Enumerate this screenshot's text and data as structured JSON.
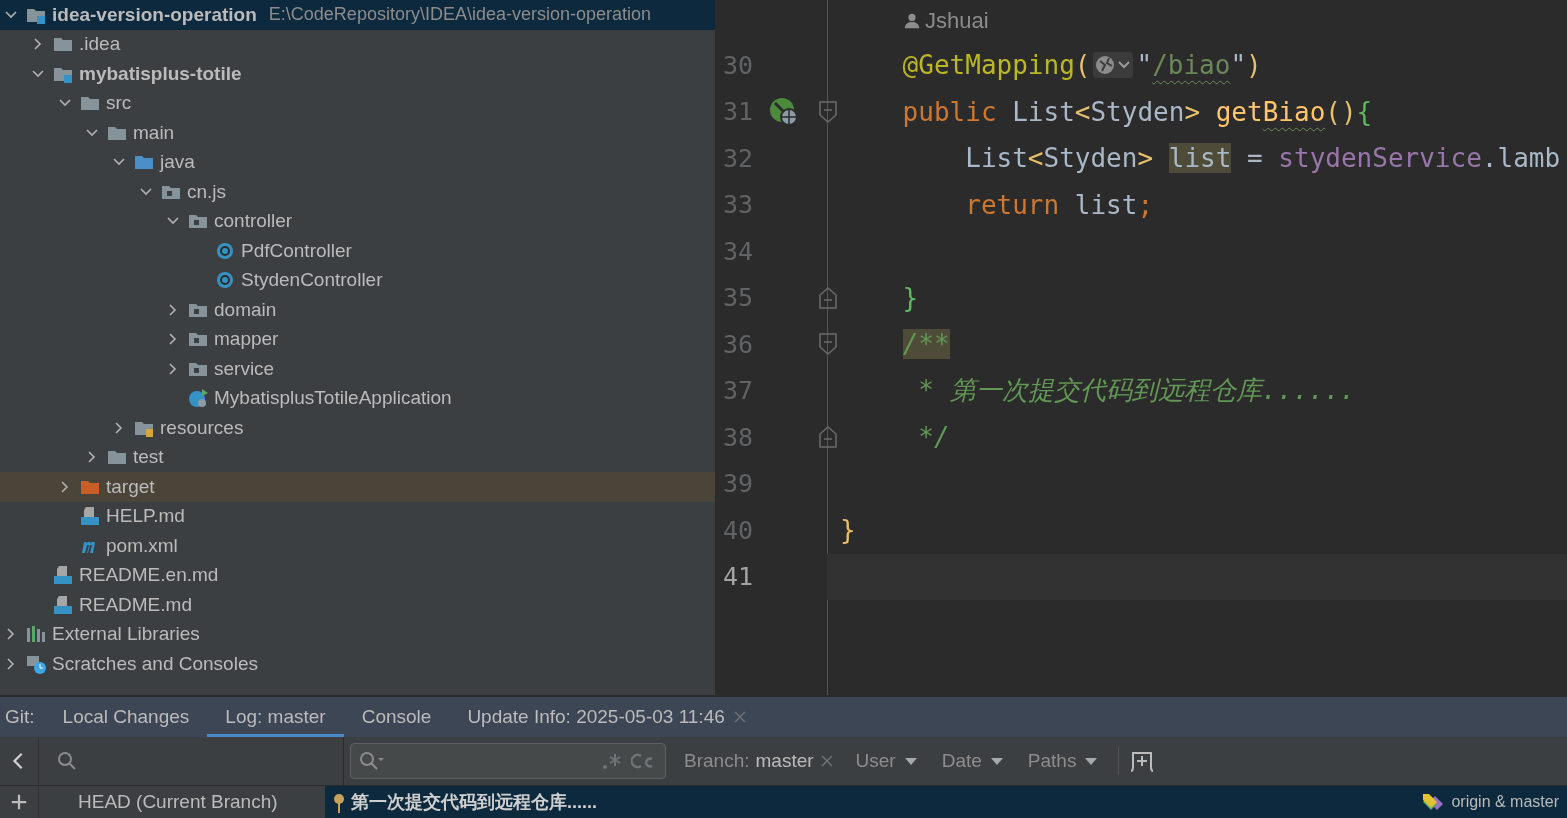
{
  "project_tree": [
    {
      "name": "idea-version-operation",
      "path": "E:\\CodeRepository\\IDEA\\idea-version-operation",
      "kind": "module",
      "expanded": true,
      "selected": true,
      "children": [
        {
          "name": ".idea",
          "kind": "folder",
          "expanded": false,
          "selected": false
        },
        {
          "name": "mybatisplus-totile",
          "kind": "module",
          "expanded": true,
          "selected": false,
          "children": [
            {
              "name": "src",
              "kind": "folder",
              "expanded": true,
              "selected": false,
              "children": [
                {
                  "name": "main",
                  "kind": "folder",
                  "expanded": true,
                  "selected": false,
                  "children": [
                    {
                      "name": "java",
                      "kind": "source-folder",
                      "expanded": true,
                      "selected": false,
                      "children": [
                        {
                          "name": "cn.js",
                          "kind": "package",
                          "expanded": true,
                          "selected": false,
                          "children": [
                            {
                              "name": "controller",
                              "kind": "package",
                              "expanded": true,
                              "selected": false,
                              "children": [
                                {
                                  "name": "PdfController",
                                  "kind": "class",
                                  "selected": false
                                },
                                {
                                  "name": "StydenController",
                                  "kind": "class",
                                  "selected": false
                                }
                              ]
                            },
                            {
                              "name": "domain",
                              "kind": "package",
                              "expanded": false,
                              "selected": false
                            },
                            {
                              "name": "mapper",
                              "kind": "package",
                              "expanded": false,
                              "selected": false
                            },
                            {
                              "name": "service",
                              "kind": "package",
                              "expanded": false,
                              "selected": false
                            },
                            {
                              "name": "MybatisplusTotileApplication",
                              "kind": "app",
                              "selected": false
                            }
                          ]
                        }
                      ]
                    },
                    {
                      "name": "resources",
                      "kind": "resources-folder",
                      "expanded": false,
                      "selected": false
                    }
                  ]
                },
                {
                  "name": "test",
                  "kind": "folder",
                  "expanded": false,
                  "selected": false
                }
              ]
            },
            {
              "name": "target",
              "kind": "excluded-folder",
              "expanded": false,
              "selected": false
            },
            {
              "name": "HELP.md",
              "kind": "markdown",
              "selected": false
            },
            {
              "name": "pom.xml",
              "kind": "maven",
              "selected": false
            }
          ]
        },
        {
          "name": "README.en.md",
          "kind": "markdown",
          "selected": false
        },
        {
          "name": "README.md",
          "kind": "markdown",
          "selected": false
        }
      ]
    },
    {
      "name": "External Libraries",
      "kind": "libraries",
      "expanded": false,
      "selected": false
    },
    {
      "name": "Scratches and Consoles",
      "kind": "scratches",
      "expanded": false,
      "selected": false
    }
  ],
  "editor": {
    "author_hint": "Jshuai",
    "lines": [
      {
        "number": "30",
        "current": false,
        "tokens": [
          {
            "kind": "annotation",
            "text": "    @GetMapping"
          },
          {
            "kind": "bracket-outer",
            "text": "("
          },
          {
            "kind": "inlay"
          },
          {
            "kind": "plain",
            "text": "\""
          },
          {
            "kind": "string-squiggly",
            "text": "/biao"
          },
          {
            "kind": "plain",
            "text": "\""
          },
          {
            "kind": "bracket-outer",
            "text": ")"
          }
        ]
      },
      {
        "number": "31",
        "current": false,
        "markers": [
          {
            "kind": "run"
          },
          {
            "kind": "fold-start"
          }
        ],
        "tokens": [
          {
            "kind": "keyword",
            "text": "    public "
          },
          {
            "kind": "plain",
            "text": "List"
          },
          {
            "kind": "bracket-outer",
            "text": "<"
          },
          {
            "kind": "plain",
            "text": "Styden"
          },
          {
            "kind": "bracket-outer",
            "text": "> "
          },
          {
            "kind": "method",
            "text": "get"
          },
          {
            "kind": "method-squiggly",
            "text": "Biao"
          },
          {
            "kind": "bracket-outer",
            "text": "()"
          },
          {
            "kind": "bracket-inner",
            "text": "{"
          }
        ]
      },
      {
        "number": "32",
        "current": false,
        "tokens": [
          {
            "kind": "plain",
            "text": "        List"
          },
          {
            "kind": "bracket-outer",
            "text": "<"
          },
          {
            "kind": "plain",
            "text": "Styden"
          },
          {
            "kind": "bracket-outer",
            "text": "> "
          },
          {
            "kind": "plain-highlighted",
            "text": "list"
          },
          {
            "kind": "plain",
            "text": " = "
          },
          {
            "kind": "field",
            "text": "stydenService"
          },
          {
            "kind": "plain",
            "text": ".lamb"
          }
        ]
      },
      {
        "number": "33",
        "current": false,
        "tokens": [
          {
            "kind": "keyword",
            "text": "        return "
          },
          {
            "kind": "plain",
            "text": "list"
          },
          {
            "kind": "keyword",
            "text": ";"
          }
        ]
      },
      {
        "number": "34",
        "current": false
      },
      {
        "number": "35",
        "current": false,
        "markers": [
          {
            "kind": "fold-end"
          }
        ],
        "tokens": [
          {
            "kind": "bracket-inner",
            "text": "    }"
          }
        ]
      },
      {
        "number": "36",
        "current": false,
        "markers": [
          {
            "kind": "fold-start"
          }
        ],
        "tokens": [
          {
            "kind": "indent"
          },
          {
            "kind": "comment-highlighted",
            "text": "/**"
          }
        ]
      },
      {
        "number": "37",
        "current": false,
        "tokens": [
          {
            "kind": "comment",
            "text": "     * 第一次提交代码到远程仓库......"
          }
        ]
      },
      {
        "number": "38",
        "current": false,
        "markers": [
          {
            "kind": "fold-end"
          }
        ],
        "tokens": [
          {
            "kind": "comment",
            "text": "     */"
          }
        ]
      },
      {
        "number": "39",
        "current": false
      },
      {
        "number": "40",
        "current": false,
        "tokens": [
          {
            "kind": "bracket-outer",
            "text": "}"
          }
        ]
      },
      {
        "number": "41",
        "current": true
      }
    ]
  },
  "git_panel": {
    "label": "Git:",
    "tabs": [
      {
        "label": "Local Changes",
        "selected": false,
        "closable": false
      },
      {
        "label": "Log: master",
        "selected": true,
        "closable": false
      },
      {
        "label": "Console",
        "selected": false,
        "closable": false
      },
      {
        "label": "Update Info: 2025-05-03 11:46",
        "selected": false,
        "closable": true
      }
    ],
    "branches": [
      "HEAD (Current Branch)"
    ],
    "filters": {
      "branch_label": "Branch:",
      "branch_value": "master",
      "menus": [
        "User",
        "Date",
        "Paths"
      ]
    },
    "commits": [
      {
        "message": "第一次提交代码到远程仓库......",
        "refs": "origin & master",
        "selected": true
      }
    ]
  }
}
